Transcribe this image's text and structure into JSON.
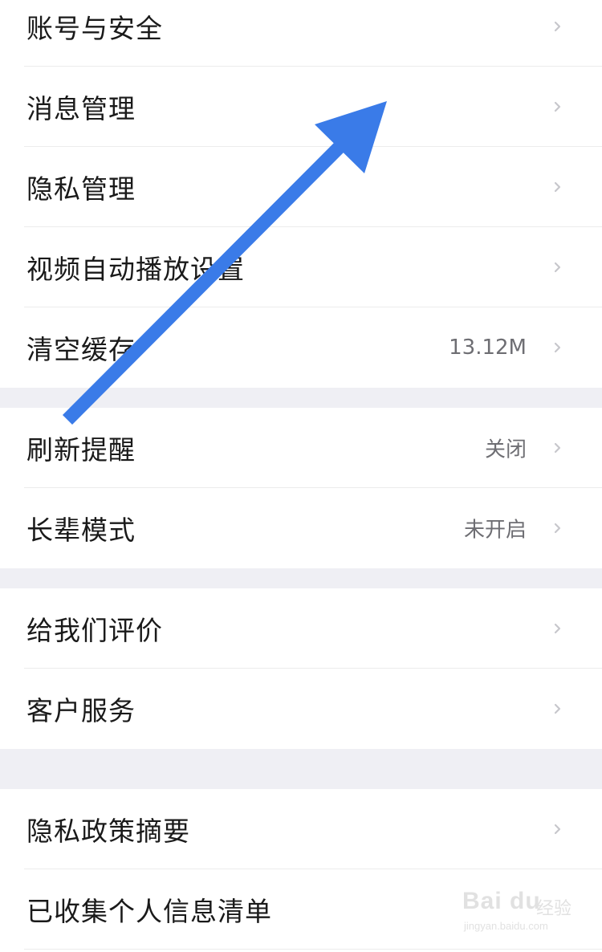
{
  "settings": {
    "groups": [
      {
        "items": [
          {
            "label": "账号与安全",
            "value": ""
          },
          {
            "label": "消息管理",
            "value": ""
          },
          {
            "label": "隐私管理",
            "value": ""
          },
          {
            "label": "视频自动播放设置",
            "value": ""
          },
          {
            "label": "清空缓存",
            "value": "13.12M"
          }
        ]
      },
      {
        "items": [
          {
            "label": "刷新提醒",
            "value": "关闭"
          },
          {
            "label": "长辈模式",
            "value": "未开启"
          }
        ]
      },
      {
        "items": [
          {
            "label": "给我们评价",
            "value": ""
          },
          {
            "label": "客户服务",
            "value": ""
          }
        ]
      },
      {
        "items": [
          {
            "label": "隐私政策摘要",
            "value": ""
          },
          {
            "label": "已收集个人信息清单",
            "value": ""
          }
        ]
      }
    ]
  },
  "overlay": {
    "arrow_color": "#3a7be8",
    "arrow_icon": "arrow-up-right-icon"
  },
  "watermark": {
    "brand": "Bai du",
    "cn": "经验",
    "url": "jingyan.baidu.com"
  },
  "colors": {
    "background": "#ffffff",
    "group_gap": "#efeff4",
    "divider": "#ececec",
    "label_text": "#1a1a1a",
    "value_text": "#6e6e73",
    "chevron": "#c7c7cc"
  }
}
